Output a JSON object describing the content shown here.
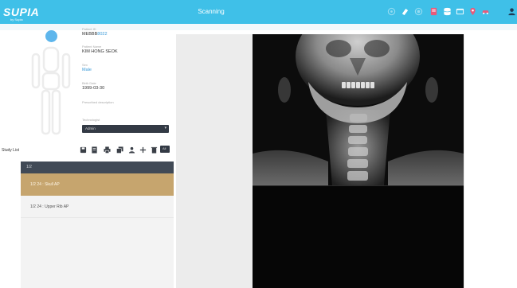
{
  "app": {
    "logo": "SUPIA",
    "logo_tagline": "by Supia",
    "title": "Scanning"
  },
  "toolbar": {
    "icons": [
      "target-icon",
      "eraser-icon",
      "circle-icon",
      "doc-icon",
      "database-icon",
      "window-icon",
      "pin-icon",
      "car-icon",
      "user-icon"
    ]
  },
  "patient": {
    "id_label": "Patient ID",
    "id_prefix": "MEBBB",
    "id_suffix": "8022",
    "name_label": "Patient Name",
    "name": "KIM HONG SEOK",
    "sex_label": "Sex",
    "sex": "Male",
    "birth_label": "Birth Date",
    "birth": "1999-03-30",
    "desc_label": "Prescribed description",
    "technologist_label": "Technologist",
    "technologist": "Admin"
  },
  "study_list": {
    "label": "Study List",
    "tool_icons": [
      "save-icon",
      "file-icon",
      "print-icon",
      "copy-icon",
      "user-add-icon",
      "plus-icon",
      "trash-icon"
    ],
    "last_button": "All",
    "header": "1/2",
    "items": [
      {
        "label": "1/2 24 : Skull AP",
        "selected": true
      },
      {
        "label": "1/2 24 : Upper Rib AP",
        "selected": false
      }
    ]
  },
  "colors": {
    "topbar": "#3fc0e8",
    "accent": "#3a9ad8",
    "selected_item": "#c6a56e",
    "dark_control": "#333a45"
  }
}
